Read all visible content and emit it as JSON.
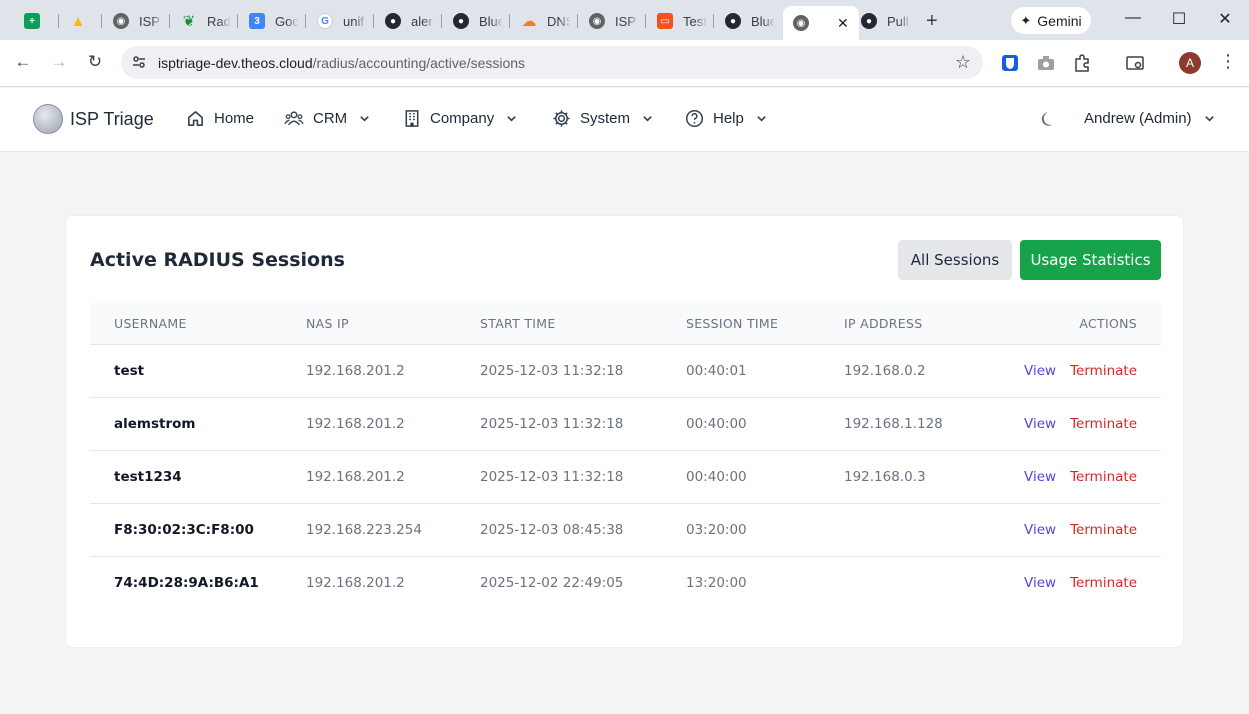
{
  "browser": {
    "tabs": [
      {
        "label": "",
        "icon": "sheets-icon",
        "color": "#0f9d58"
      },
      {
        "label": "",
        "icon": "drive-icon",
        "color": "#fbbc04"
      },
      {
        "label": "ISP",
        "icon": "globe-icon",
        "color": "#5f6368"
      },
      {
        "label": "Rad",
        "icon": "leaf-icon",
        "color": "#1e8e3e"
      },
      {
        "label": "Goo",
        "icon": "calendar-icon",
        "color": "#4285f4"
      },
      {
        "label": "unif",
        "icon": "google-icon",
        "color": "#4285f4"
      },
      {
        "label": "aler",
        "icon": "github-icon",
        "color": "#24292f"
      },
      {
        "label": "Blue",
        "icon": "github-icon",
        "color": "#24292f"
      },
      {
        "label": "DNS",
        "icon": "cloudflare-icon",
        "color": "#f38020"
      },
      {
        "label": "ISP",
        "icon": "globe-icon",
        "color": "#5f6368"
      },
      {
        "label": "Test",
        "icon": "slides-icon",
        "color": "#f4511e"
      },
      {
        "label": "Blue",
        "icon": "github-icon",
        "color": "#24292f"
      },
      {
        "label": "",
        "icon": "globe-icon",
        "color": "#5f6368",
        "active": true
      },
      {
        "label": "Pull",
        "icon": "github-icon",
        "color": "#24292f"
      }
    ],
    "gemini_label": "Gemini",
    "url_host": "isptriage-dev.theos.cloud",
    "url_path": "/radius/accounting/active/sessions",
    "profile_initial": "A"
  },
  "app": {
    "brand": "ISP Triage",
    "nav": {
      "home": "Home",
      "crm": "CRM",
      "company": "Company",
      "system": "System",
      "help": "Help"
    },
    "user": "Andrew (Admin)"
  },
  "sessions": {
    "title": "Active RADIUS Sessions",
    "btn_all": "All Sessions",
    "btn_usage": "Usage Statistics",
    "columns": {
      "username": "USERNAME",
      "nas_ip": "NAS IP",
      "start_time": "START TIME",
      "session_time": "SESSION TIME",
      "ip_address": "IP ADDRESS",
      "actions": "ACTIONS"
    },
    "view_label": "View",
    "terminate_label": "Terminate",
    "rows": [
      {
        "username": "test",
        "nas_ip": "192.168.201.2",
        "start_time": "2025-12-03 11:32:18",
        "session_time": "00:40:01",
        "ip_address": "192.168.0.2"
      },
      {
        "username": "alemstrom",
        "nas_ip": "192.168.201.2",
        "start_time": "2025-12-03 11:32:18",
        "session_time": "00:40:00",
        "ip_address": "192.168.1.128"
      },
      {
        "username": "test1234",
        "nas_ip": "192.168.201.2",
        "start_time": "2025-12-03 11:32:18",
        "session_time": "00:40:00",
        "ip_address": "192.168.0.3"
      },
      {
        "username": "F8:30:02:3C:F8:00",
        "nas_ip": "192.168.223.254",
        "start_time": "2025-12-03 08:45:38",
        "session_time": "03:20:00",
        "ip_address": ""
      },
      {
        "username": "74:4D:28:9A:B6:A1",
        "nas_ip": "192.168.201.2",
        "start_time": "2025-12-02 22:49:05",
        "session_time": "13:20:00",
        "ip_address": ""
      }
    ]
  }
}
